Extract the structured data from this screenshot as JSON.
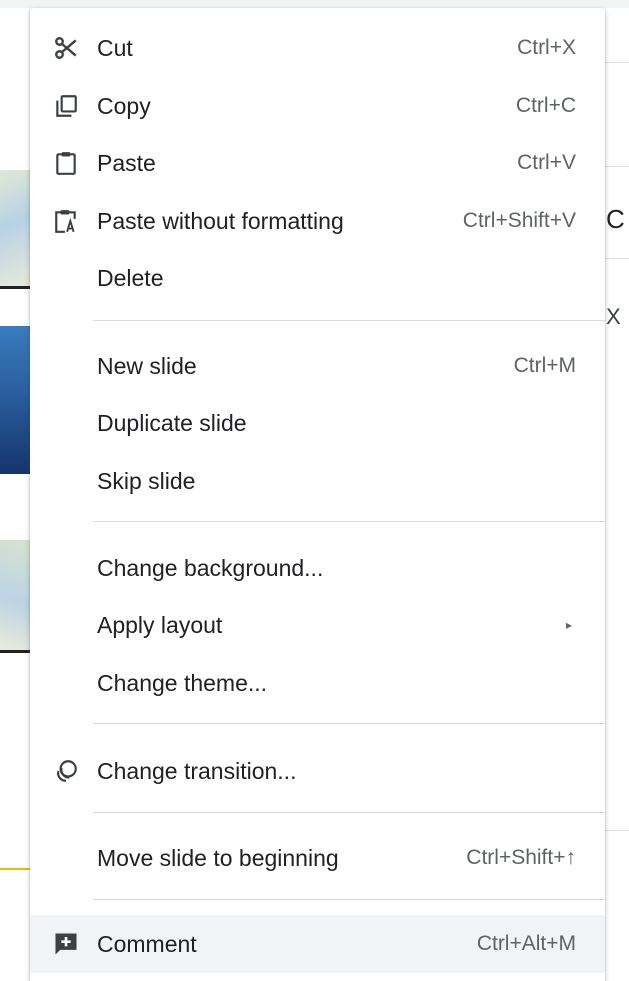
{
  "menu": {
    "items": [
      {
        "label": "Cut",
        "shortcut": "Ctrl+X",
        "icon": "scissors-icon"
      },
      {
        "label": "Copy",
        "shortcut": "Ctrl+C",
        "icon": "copy-icon"
      },
      {
        "label": "Paste",
        "shortcut": "Ctrl+V",
        "icon": "clipboard-icon"
      },
      {
        "label": "Paste without formatting",
        "shortcut": "Ctrl+Shift+V",
        "icon": "clipboard-text-icon"
      },
      {
        "label": "Delete",
        "shortcut": ""
      },
      {
        "label": "New slide",
        "shortcut": "Ctrl+M"
      },
      {
        "label": "Duplicate slide",
        "shortcut": ""
      },
      {
        "label": "Skip slide",
        "shortcut": ""
      },
      {
        "label": "Change background...",
        "shortcut": ""
      },
      {
        "label": "Apply layout",
        "shortcut": "",
        "submenu": true
      },
      {
        "label": "Change theme...",
        "shortcut": ""
      },
      {
        "label": "Change transition...",
        "shortcut": "",
        "icon": "transition-icon"
      },
      {
        "label": "Move slide to beginning",
        "shortcut": "Ctrl+Shift+↑"
      },
      {
        "label": "Comment",
        "shortcut": "Ctrl+Alt+M",
        "icon": "add-comment-icon",
        "highlighted": true
      }
    ],
    "submenu_arrow": "▸"
  },
  "background": {
    "right_heading_glyph": "C",
    "right_text_glyph": "X"
  },
  "colors": {
    "menu_bg": "#ffffff",
    "hover_bg": "#f1f3f4",
    "text": "#202124",
    "shortcut": "#5f6368",
    "separator": "#dadce0"
  }
}
